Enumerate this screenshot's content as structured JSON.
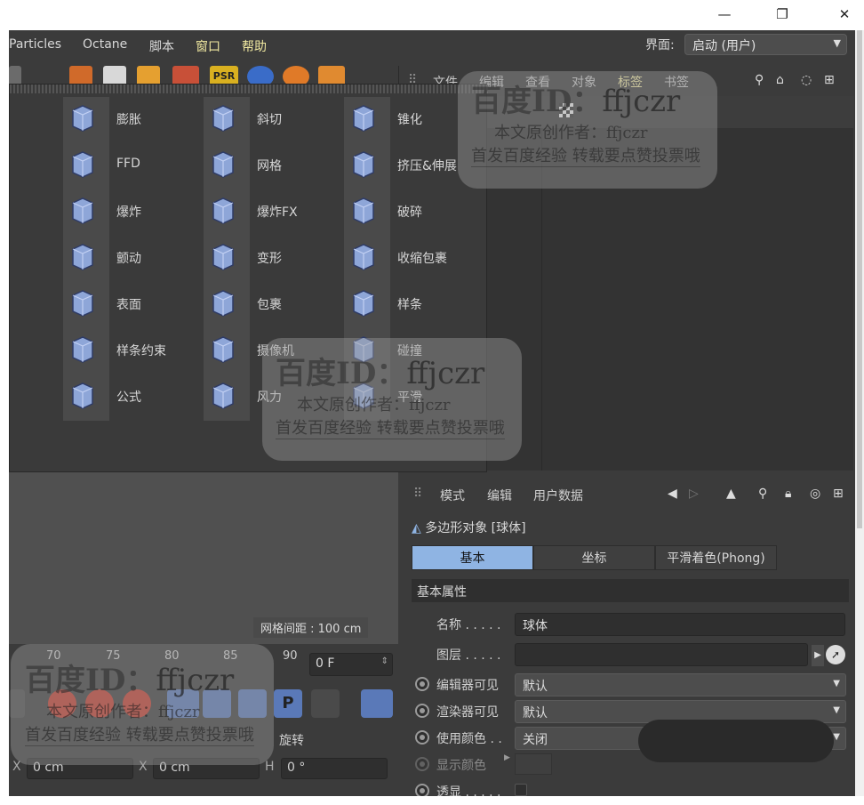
{
  "window": {
    "minimize": "—",
    "restore": "❐",
    "close": "✕"
  },
  "menu": {
    "items": [
      "Particles",
      "Octane",
      "脚本",
      "窗口",
      "帮助"
    ],
    "layout_label": "界面:",
    "layout_value": "启动 (用户)"
  },
  "objects_panel": {
    "menu": [
      "文件",
      "编辑",
      "查看",
      "对象",
      "标签",
      "书签"
    ]
  },
  "deformers": {
    "col1": [
      "膨胀",
      "FFD",
      "爆炸",
      "颤动",
      "表面",
      "样条约束",
      "公式"
    ],
    "col2": [
      "斜切",
      "网格",
      "爆炸FX",
      "变形",
      "包裹",
      "摄像机",
      "风力"
    ],
    "col3": [
      "锥化",
      "挤压&伸展",
      "破碎",
      "收缩包裹",
      "样条",
      "碰撞",
      "平滑"
    ]
  },
  "viewport": {
    "grid_spacing": "网格间距 : 100 cm"
  },
  "timeline": {
    "ticks": [
      "70",
      "75",
      "80",
      "85",
      "90"
    ],
    "frame": "0 F"
  },
  "attributes": {
    "menu": [
      "模式",
      "编辑",
      "用户数据"
    ],
    "object_title": "多边形对象 [球体]",
    "tabs": [
      "基本",
      "坐标",
      "平滑着色(Phong)"
    ],
    "section": "基本属性",
    "name_label": "名称 . . . . .",
    "name_value": "球体",
    "layer_label": "图层 . . . . .",
    "editor_visible_label": "编辑器可见",
    "editor_visible_value": "默认",
    "render_visible_label": "渲染器可见",
    "render_visible_value": "默认",
    "use_color_label": "使用颜色 . .",
    "use_color_value": "关闭",
    "display_color_label": "显示颜色",
    "xray_label": "透显 . . . . ."
  },
  "coords": {
    "rotate_label": "旋转",
    "x1": "0 cm",
    "x2": "0 cm",
    "h": "0 °",
    "x1_label": "X",
    "x2_label": "X",
    "h_label": "H"
  },
  "watermark": {
    "brand": "百度ID：",
    "id": "ffjczr",
    "line1": "本文原创作者：ffjczr",
    "line2": "首发百度经验 转载要点赞投票哦"
  },
  "colors": {
    "bg": "#3b3b3b",
    "tab_active": "#8fb4e3",
    "deformer_icon": "#8ea6d8"
  }
}
